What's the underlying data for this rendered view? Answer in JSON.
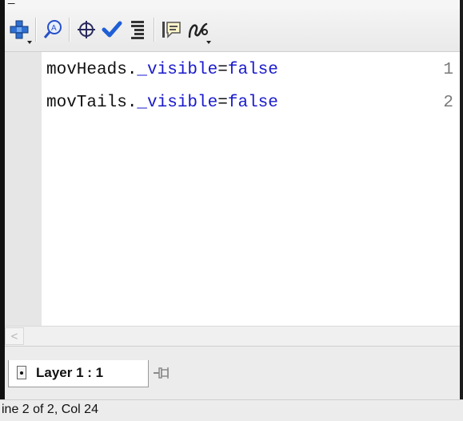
{
  "toolbar": {
    "icons": [
      "add-statement-icon",
      "find-icon",
      "insert-target-path-icon",
      "check-syntax-icon",
      "auto-format-icon",
      "code-hint-icon",
      "debug-options-icon"
    ]
  },
  "editor": {
    "lines": [
      {
        "number": "1",
        "object": "movHeads.",
        "property": "_visible",
        "operator": "=",
        "value": "false"
      },
      {
        "number": "2",
        "object": "movTails.",
        "property": "_visible",
        "operator": "=",
        "value": "false"
      }
    ]
  },
  "scrollbar": {
    "left_arrow": "<"
  },
  "tabs": {
    "layer_label": "Layer 1 : 1"
  },
  "status": {
    "text": "ine 2 of 2, Col 24"
  },
  "colors": {
    "keyword": "#1a1acc",
    "gutter": "#e6e6e6",
    "line_number": "#7a7a7a"
  }
}
